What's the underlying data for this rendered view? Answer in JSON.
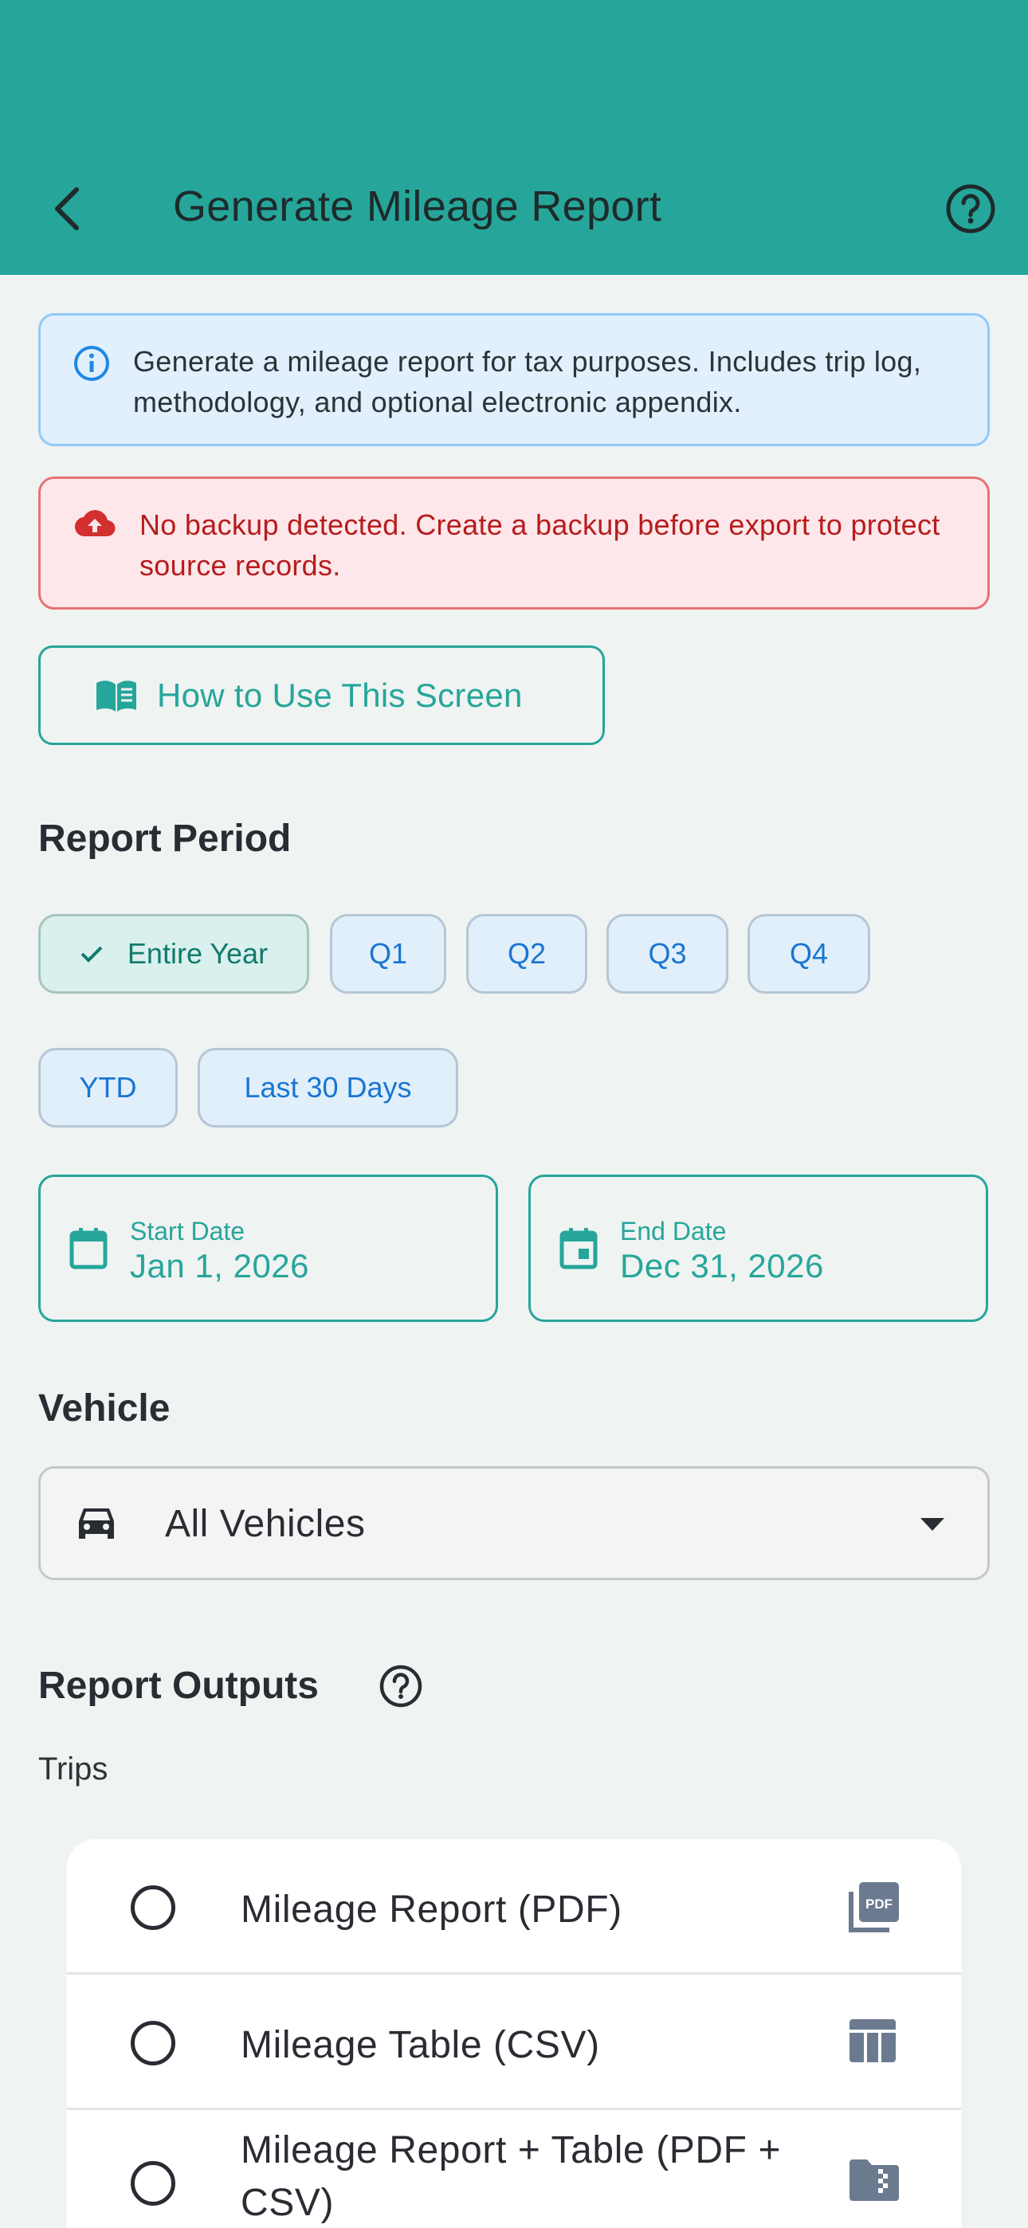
{
  "app_bar": {
    "title": "Generate Mileage Report",
    "background": "#26a69a",
    "back_icon": "chevron-left-icon",
    "help_icon": "help-circle-icon"
  },
  "info_banner": {
    "icon": "info-icon",
    "text": "Generate a mileage report for tax purposes. Includes trip log, methodology, and optional electronic appendix."
  },
  "warning_banner": {
    "icon": "cloud-upload-icon",
    "text": "No backup detected. Create a backup before export to protect source records."
  },
  "how_to_button": {
    "icon": "book-open-icon",
    "label": "How to Use This Screen"
  },
  "report_period": {
    "title": "Report Period",
    "chips": [
      {
        "label": "Entire Year",
        "selected": true
      },
      {
        "label": "Q1",
        "selected": false
      },
      {
        "label": "Q2",
        "selected": false
      },
      {
        "label": "Q3",
        "selected": false
      },
      {
        "label": "Q4",
        "selected": false
      },
      {
        "label": "YTD",
        "selected": false
      },
      {
        "label": "Last 30 Days",
        "selected": false
      }
    ],
    "start_date": {
      "label": "Start Date",
      "value": "Jan 1, 2026"
    },
    "end_date": {
      "label": "End Date",
      "value": "Dec 31, 2026"
    }
  },
  "vehicle": {
    "title": "Vehicle",
    "selected": "All Vehicles"
  },
  "report_outputs": {
    "title": "Report Outputs",
    "subheading": "Trips",
    "options": [
      {
        "label": "Mileage Report (PDF)",
        "icon": "pdf-file-icon",
        "selected": false
      },
      {
        "label": "Mileage Table (CSV)",
        "icon": "table-icon",
        "selected": false
      },
      {
        "label": "Mileage Report + Table (PDF + CSV)",
        "icon": "zip-folder-icon",
        "selected": false
      }
    ]
  }
}
